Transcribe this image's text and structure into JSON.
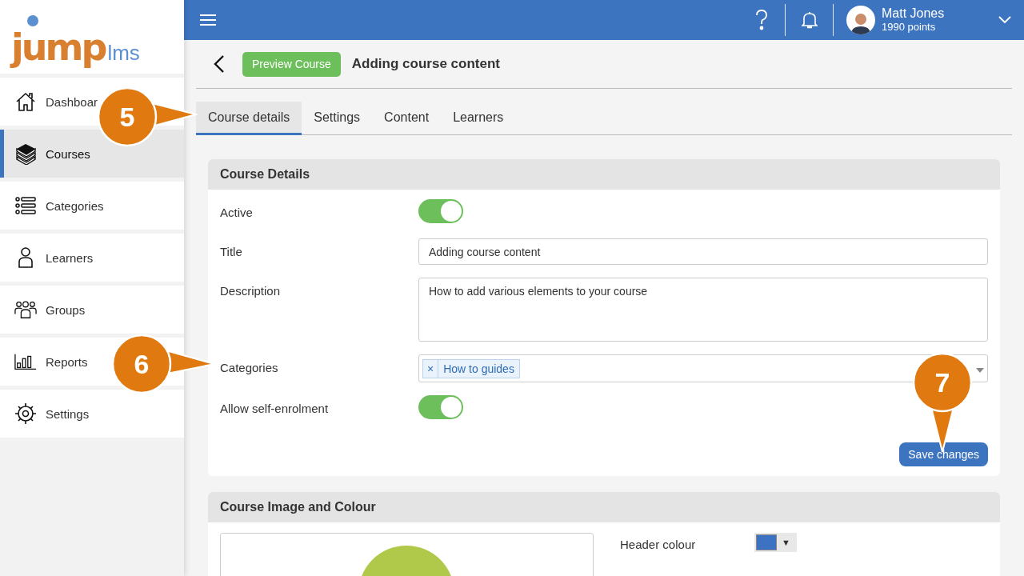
{
  "logo": {
    "main": "jump",
    "suffix": "lms"
  },
  "sidebar": {
    "items": [
      {
        "label": "Dashboar",
        "selected": false
      },
      {
        "label": "Courses",
        "selected": true
      },
      {
        "label": "Categories",
        "selected": false
      },
      {
        "label": "Learners",
        "selected": false
      },
      {
        "label": "Groups",
        "selected": false
      },
      {
        "label": "Reports",
        "selected": false
      },
      {
        "label": "Settings",
        "selected": false
      }
    ]
  },
  "topbar": {
    "user": {
      "name": "Matt Jones",
      "points": "1990 points"
    }
  },
  "header": {
    "preview_button": "Preview Course",
    "title": "Adding course content"
  },
  "tabs": [
    {
      "label": "Course details",
      "selected": true
    },
    {
      "label": "Settings",
      "selected": false
    },
    {
      "label": "Content",
      "selected": false
    },
    {
      "label": "Learners",
      "selected": false
    }
  ],
  "course_details": {
    "heading": "Course Details",
    "fields": [
      {
        "kind": "toggle",
        "label": "Active",
        "on": true
      },
      {
        "kind": "text",
        "label": "Title",
        "value": "Adding course content"
      },
      {
        "kind": "textarea",
        "label": "Description",
        "value": "How to add various elements to your course"
      },
      {
        "kind": "tags",
        "label": "Categories",
        "tags": [
          {
            "remove": "×",
            "label": "How to guides"
          }
        ]
      },
      {
        "kind": "toggle",
        "label": "Allow self-enrolment",
        "on": true
      }
    ],
    "save_button": "Save changes"
  },
  "image_and_colour": {
    "heading": "Course Image and Colour",
    "colours": [
      {
        "label": "Header colour",
        "color": "#3d72c2",
        "caret": "▼"
      }
    ]
  },
  "callouts": [
    {
      "number": "5"
    },
    {
      "number": "6"
    },
    {
      "number": "7"
    }
  ]
}
